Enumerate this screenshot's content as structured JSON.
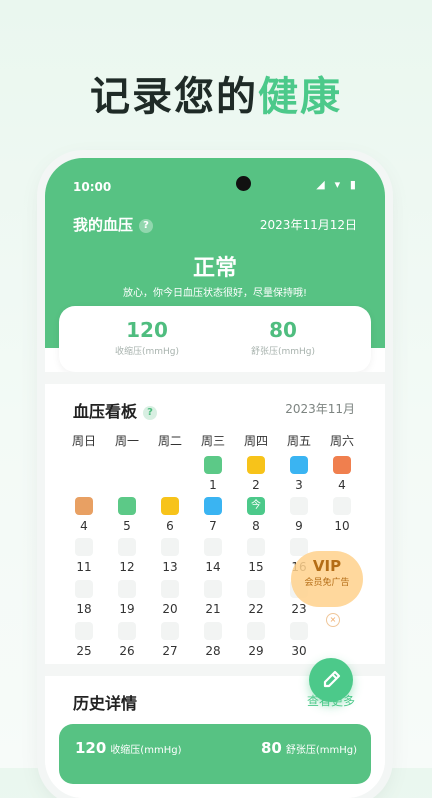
{
  "headline": {
    "part1": "记录您的",
    "part2": "健康"
  },
  "status_bar": {
    "time": "10:00",
    "icons": "◢ ▾ ▮"
  },
  "blood_pressure": {
    "title": "我的血压",
    "help": "?",
    "date": "2023年11月12日",
    "status": "正常",
    "message": "放心，你今日血压状态很好，尽量保持哦!",
    "systolic": {
      "value": "120",
      "label": "收缩压(mmHg)"
    },
    "diastolic": {
      "value": "80",
      "label": "舒张压(mmHg)"
    }
  },
  "kanban": {
    "title": "血压看板",
    "help": "?",
    "month": "2023年11月",
    "weekdays": [
      "周日",
      "周一",
      "周二",
      "周三",
      "周四",
      "周五",
      "周六"
    ],
    "today_mark": "今",
    "colors": {
      "green": "#5cc987",
      "yellow": "#f7c31a",
      "blue": "#3ab4f2",
      "orange": "#f07f4e",
      "tan": "#e8a063",
      "empty": "#f2f4f3"
    }
  },
  "vip": {
    "title": "VIP",
    "text": "会员免广告",
    "close": "×"
  },
  "history": {
    "title": "历史详情",
    "more": "查看更多",
    "systolic_value": "120",
    "systolic_label": "收缩压(mmHg)",
    "diastolic_value": "80",
    "diastolic_label": "舒张压(mmHg)"
  }
}
